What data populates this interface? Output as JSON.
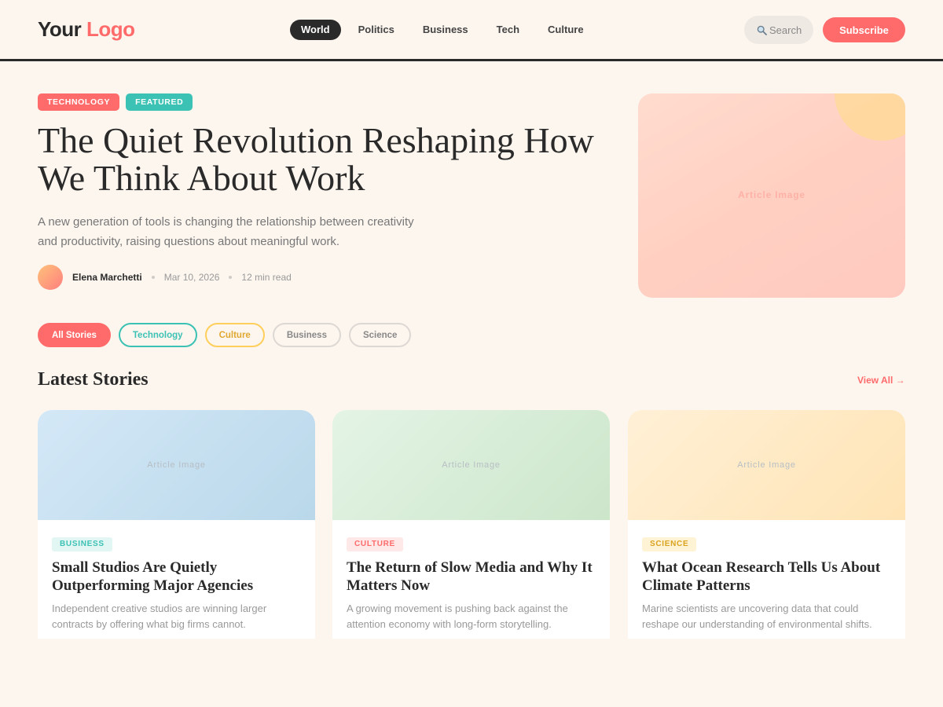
{
  "header": {
    "logo_part1": "Your",
    "logo_part2": "Logo",
    "nav": [
      "World",
      "Politics",
      "Business",
      "Tech",
      "Culture"
    ],
    "active_nav": "World",
    "search_placeholder": "Search",
    "subscribe_label": "Subscribe"
  },
  "hero": {
    "tags": [
      {
        "label": "TECHNOLOGY",
        "color": "#ff6b6b"
      },
      {
        "label": "FEATURED",
        "color": "#3cc2b4"
      }
    ],
    "title": "The Quiet Revolution Reshaping How We Think About Work",
    "description": "A new generation of tools is changing the relationship between creativity and productivity, raising questions about meaningful work.",
    "author": "Elena Marchetti",
    "date": "Mar 10, 2026",
    "read_time": "12 min read",
    "image_label": "Article Image"
  },
  "filters": [
    "All Stories",
    "Technology",
    "Culture",
    "Business",
    "Science"
  ],
  "section": {
    "title": "Latest Stories",
    "view_all": "View All →"
  },
  "cards": [
    {
      "tag": "BUSINESS",
      "title": "Small Studios Are Quietly Outperforming Major Agencies",
      "description": "Independent creative studios are winning larger contracts by offering what big firms cannot.",
      "image_label": "Article Image"
    },
    {
      "tag": "CULTURE",
      "title": "The Return of Slow Media and Why It Matters Now",
      "description": "A growing movement is pushing back against the attention economy with long-form storytelling.",
      "image_label": "Article Image"
    },
    {
      "tag": "SCIENCE",
      "title": "What Ocean Research Tells Us About Climate Patterns",
      "description": "Marine scientists are uncovering data that could reshape our understanding of environmental shifts.",
      "image_label": "Article Image"
    }
  ],
  "colors": {
    "accent": "#ff6b6b",
    "teal": "#3cc2b4",
    "yellow": "#ffcf5c",
    "background": "#fdf6ef",
    "dark": "#2a2a2a"
  }
}
